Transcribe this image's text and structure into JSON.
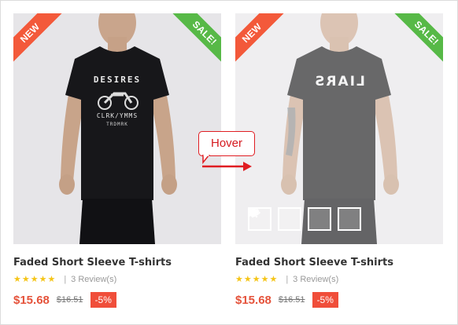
{
  "products": [
    {
      "badge_new": "NEW",
      "badge_sale": "SALE!",
      "shirt_print_top": "DESIRES",
      "shirt_print_bottom": "CLRK/YMMS",
      "shirt_print_small": "TRDMRK",
      "title": "Faded Short Sleeve T-shirts",
      "rating_stars": "★★★★★",
      "rating_value": 5,
      "separator": "|",
      "reviews": "3 Review(s)",
      "price": "$15.68",
      "old_price": "$16.51",
      "discount": "-5%"
    },
    {
      "badge_new": "NEW",
      "badge_sale": "SALE!",
      "shirt_print_top": "LIARS",
      "title": "Faded Short Sleeve T-shirts",
      "rating_stars": "★★★★★",
      "rating_value": 5,
      "separator": "|",
      "reviews": "3 Review(s)",
      "price": "$15.68",
      "old_price": "$16.51",
      "discount": "-5%",
      "actions": [
        "cart-icon",
        "heart-icon",
        "refresh-icon",
        "eye-icon"
      ]
    }
  ],
  "annotation": {
    "label": "Hover"
  },
  "colors": {
    "new_badge": "#f3593a",
    "sale_badge": "#57b947",
    "price": "#e5533b",
    "discount": "#f04e3a",
    "hover": "#e01d22",
    "stars": "#f5c518"
  }
}
